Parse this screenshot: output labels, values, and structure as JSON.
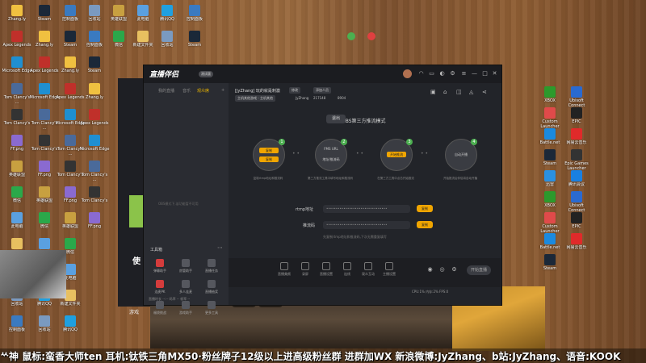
{
  "desktop_icons_left": [
    {
      "label": "Zhang.ly",
      "color": "#f0c040"
    },
    {
      "label": "Apex Legends",
      "color": "#c0302a"
    },
    {
      "label": "Microsoft Edge",
      "color": "#1f8fd1"
    },
    {
      "label": "Tom Clancy's ...",
      "color": "#4a6a9a"
    },
    {
      "label": "Tom Clancy's",
      "color": "#333"
    },
    {
      "label": "FF.png",
      "color": "#8a6ad0"
    },
    {
      "label": "英雄联盟",
      "color": "#c8a040"
    },
    {
      "label": "微信",
      "color": "#2aa84a"
    },
    {
      "label": "此电脑",
      "color": "#5aa0e0"
    },
    {
      "label": "新建文件夹",
      "color": "#e8c060"
    },
    {
      "label": "腾讯QQ",
      "color": "#1fa0e0"
    },
    {
      "label": "回收站",
      "color": "#7a9ac0"
    },
    {
      "label": "控制面板",
      "color": "#3a7ac0"
    },
    {
      "label": "Steam",
      "color": "#1b2838"
    }
  ],
  "desktop_icons_right": [
    {
      "label": "XBOX",
      "color": "#2c9a2c"
    },
    {
      "label": "Ubisoft Connect",
      "color": "#2a6ad0"
    },
    {
      "label": "Custom Launcher",
      "color": "#e04a4a"
    },
    {
      "label": "EPIC",
      "color": "#222"
    },
    {
      "label": "Battle.net",
      "color": "#1a8ae0"
    },
    {
      "label": "网易云音乐",
      "color": "#e02a2a"
    },
    {
      "label": "Steam",
      "color": "#1b2838"
    },
    {
      "label": "Epic Games Launcher",
      "color": "#333"
    },
    {
      "label": "迅雷",
      "color": "#2a90e0"
    },
    {
      "label": "腾讯会议",
      "color": "#1a80e0"
    }
  ],
  "behind_window": {
    "title": "使",
    "subtitle": "游戏"
  },
  "app": {
    "name": "直播伴侣",
    "badge": "测试版",
    "left_tabs": [
      "我的直播",
      "音乐",
      "观众席"
    ],
    "left_hint": "OBS模式下,该功能暂不可用",
    "tools_title": "工具箱",
    "tools": [
      {
        "label": "弹幕助手",
        "red": true
      },
      {
        "label": "房管助手",
        "red": false
      },
      {
        "label": "直播任务",
        "red": false
      },
      {
        "label": "连麦PK",
        "red": true
      },
      {
        "label": "多人连麦",
        "red": false
      },
      {
        "label": "直播抽奖",
        "red": false
      },
      {
        "label": "福袋挑战",
        "red": false
      },
      {
        "label": "游戏助手",
        "red": false
      },
      {
        "label": "更多工具",
        "red": false
      }
    ],
    "footer": "直播时长 --:--    码率 --    帧率 --"
  },
  "room": {
    "title": "[JyZhang] 玩的就是刺激",
    "tag1": "修改",
    "tag2": "添加人员",
    "category": "主机其他游戏 - 主机其他",
    "user": "JyZhang",
    "id": "217148",
    "fans": "8904"
  },
  "obs": {
    "mode_title": "OBS第三方推流模式",
    "exit_label": "退出",
    "steps": [
      {
        "num": "1",
        "btn1": "复制",
        "btn2": "复制",
        "label": "复制rtmp地址和推流码"
      },
      {
        "num": "2",
        "top": "FMS URL",
        "bottom": "地址/推流码",
        "label": "第三方推流工具中填写地址和推流码"
      },
      {
        "num": "3",
        "btn1": "开始推流",
        "label": "在第三方工具中点击开始推流"
      },
      {
        "num": "4",
        "top": "自动开播",
        "label": "开始推流后伴侣将自动开播"
      }
    ],
    "rtmp_label": "rtmp地址",
    "rtmp_value": "••••••••••••••••••••••••••••••••",
    "code_label": "推流码",
    "code_value": "••••••••••••••••••••••••••••••••",
    "copy_label": "复制",
    "hint": "先复制rtmp地址和推流码,下次无需重复填写"
  },
  "bottom_tools": [
    "直播美颜",
    "录屏",
    "直播设置",
    "连线",
    "观众互动",
    "主播设置"
  ],
  "start_label": "开始直播",
  "stats": "CPU:1%   内存:2%   FPS:0",
  "danmu": [
    "●开播提醒",
    "●加群分享"
  ],
  "ticker": "ᄿ神 鼠标:蛮香大师ten 耳机:钛铁三角MX50·粉丝牌子12级以上进高级粉丝群 进群加WX 新浪微博:JyZhang、b站:JyZhang、语音:KOOK"
}
